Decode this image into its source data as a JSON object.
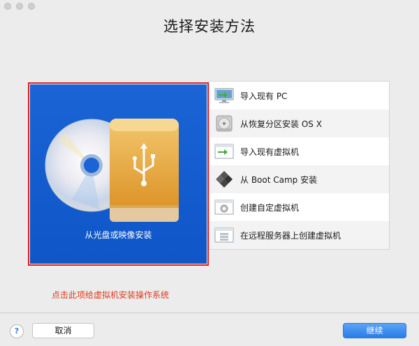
{
  "window": {
    "title": "选择安装方法"
  },
  "hero": {
    "label": "从光盘或映像安装",
    "accent": "#1a64d6",
    "border_color": "#e02020"
  },
  "methods": [
    {
      "label": "导入现有 PC",
      "icon": "monitor-icon"
    },
    {
      "label": "从恢复分区安装 OS X",
      "icon": "hard-drive-icon"
    },
    {
      "label": "导入现有虚拟机",
      "icon": "import-window-icon"
    },
    {
      "label": "从 Boot Camp 安装",
      "icon": "boot-camp-icon"
    },
    {
      "label": "创建自定虚拟机",
      "icon": "gear-window-icon"
    },
    {
      "label": "在远程服务器上创建虚拟机",
      "icon": "server-window-icon"
    }
  ],
  "note": "点击此项给虚拟机安装操作系统",
  "buttons": {
    "help": "?",
    "cancel": "取消",
    "continue": "继续"
  }
}
